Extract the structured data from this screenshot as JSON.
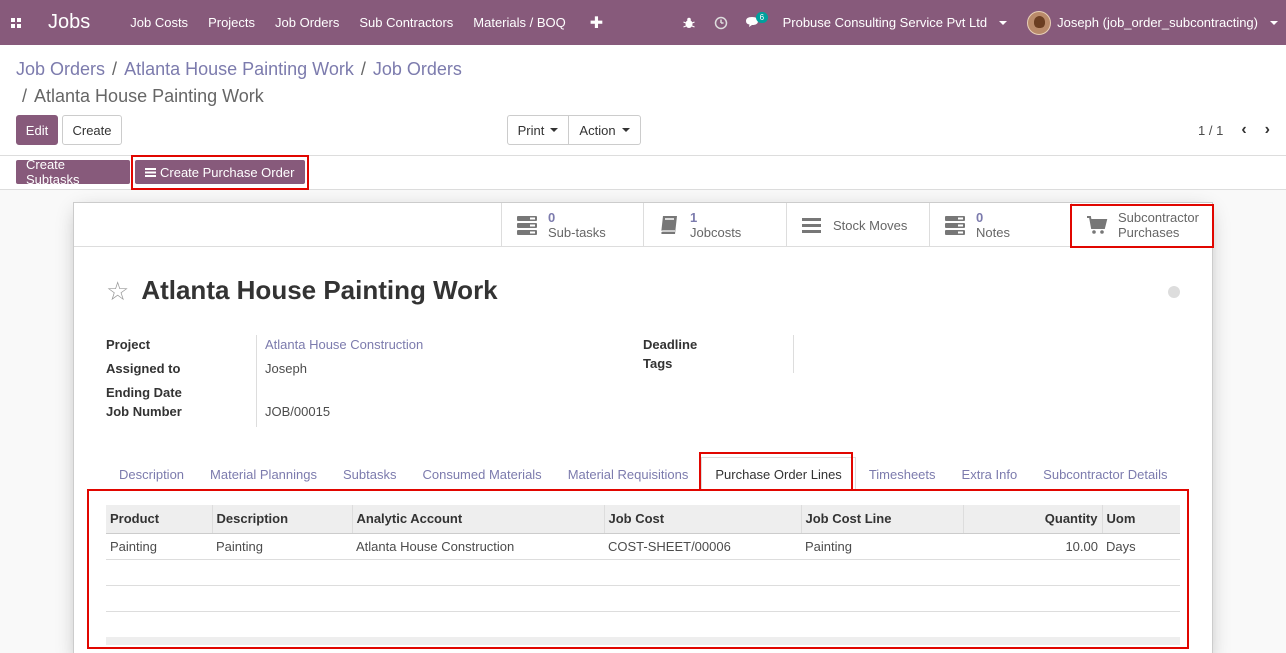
{
  "nav": {
    "app_title": "Jobs",
    "menus": [
      "Job Costs",
      "Projects",
      "Job Orders",
      "Sub Contractors",
      "Materials / BOQ"
    ],
    "plus": "✚",
    "chat_count": "6",
    "company": "Probuse Consulting Service Pvt Ltd",
    "user": "Joseph (job_order_subcontracting)"
  },
  "breadcrumb": {
    "items": [
      "Job Orders",
      "Atlanta House Painting Work",
      "Job Orders"
    ],
    "separator": "/",
    "current": "Atlanta House Painting Work"
  },
  "toolbar": {
    "edit": "Edit",
    "create": "Create",
    "print": "Print",
    "action": "Action",
    "pager": "1 / 1"
  },
  "statusbar": {
    "create_subtasks": "Create Subtasks",
    "create_po": "Create Purchase Order"
  },
  "smart_buttons": {
    "subtasks": {
      "count": "0",
      "label": "Sub-tasks"
    },
    "jobcosts": {
      "count": "1",
      "label": "Jobcosts"
    },
    "stock_moves": {
      "label": "Stock Moves"
    },
    "notes": {
      "count": "0",
      "label": "Notes"
    },
    "subcontractor": {
      "line1": "Subcontractor",
      "line2": "Purchases"
    }
  },
  "record": {
    "title": "Atlanta House Painting Work",
    "labels": {
      "project": "Project",
      "assigned_to": "Assigned to",
      "ending_date": "Ending Date",
      "job_number": "Job Number",
      "deadline": "Deadline",
      "tags": "Tags"
    },
    "project": "Atlanta House Construction",
    "assigned_to": "Joseph",
    "job_number": "JOB/00015"
  },
  "tabs": [
    "Description",
    "Material Plannings",
    "Subtasks",
    "Consumed Materials",
    "Material Requisitions",
    "Purchase Order Lines",
    "Timesheets",
    "Extra Info",
    "Subcontractor Details"
  ],
  "po_lines": {
    "headers": {
      "product": "Product",
      "description": "Description",
      "analytic": "Analytic Account",
      "job_cost": "Job Cost",
      "job_cost_line": "Job Cost Line",
      "quantity": "Quantity",
      "uom": "Uom"
    },
    "rows": [
      {
        "product": "Painting",
        "description": "Painting",
        "analytic": "Atlanta House Construction",
        "job_cost": "COST-SHEET/00006",
        "job_cost_line": "Painting",
        "quantity": "10.00",
        "uom": "Days"
      }
    ]
  },
  "colors": {
    "brand": "#875a7b",
    "link": "#7c7bad",
    "highlight": "#e10600"
  }
}
